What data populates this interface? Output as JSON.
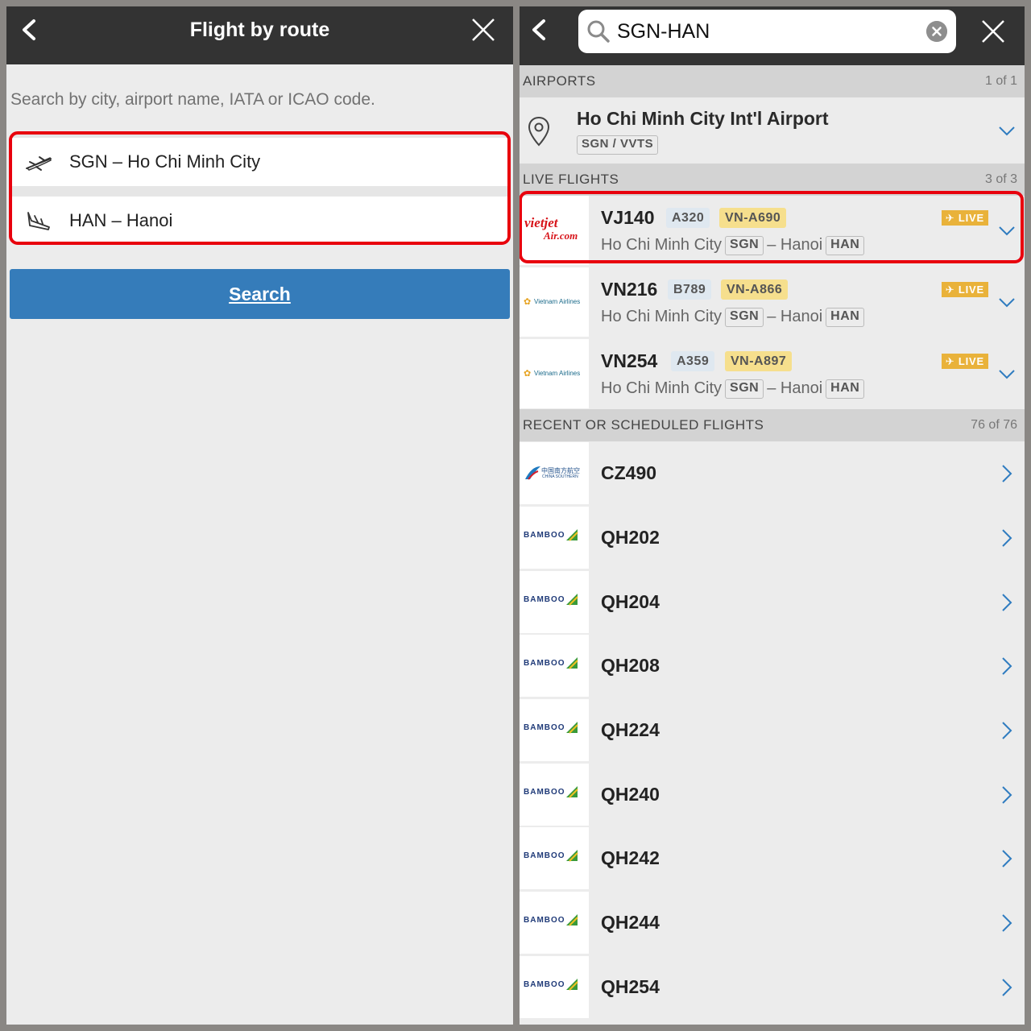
{
  "left": {
    "title": "Flight by route",
    "hint": "Search by city, airport name, IATA or ICAO code.",
    "origin": "SGN – Ho Chi Minh City",
    "destination": "HAN – Hanoi",
    "search_label": "Search"
  },
  "right": {
    "search_value": "SGN-HAN",
    "airports": {
      "title": "AIRPORTS",
      "count": "1 of 1",
      "items": [
        {
          "name": "Ho Chi Minh City Int'l Airport",
          "code": "SGN / VVTS"
        }
      ]
    },
    "live": {
      "title": "LIVE FLIGHTS",
      "count": "3 of 3",
      "badge": "LIVE",
      "items": [
        {
          "flight": "VJ140",
          "aircraft": "A320",
          "reg": "VN-A690",
          "from_city": "Ho Chi Minh City",
          "from_code": "SGN",
          "to_city": "Hanoi",
          "to_code": "HAN",
          "airline_logo": "vietjet-logo",
          "logo_text1": "vietjet",
          "logo_text2": "Air.com"
        },
        {
          "flight": "VN216",
          "aircraft": "B789",
          "reg": "VN-A866",
          "from_city": "Ho Chi Minh City",
          "from_code": "SGN",
          "to_city": "Hanoi",
          "to_code": "HAN",
          "airline_logo": "vietnam-airlines-logo",
          "logo_text1": "Vietnam Airlines"
        },
        {
          "flight": "VN254",
          "aircraft": "A359",
          "reg": "VN-A897",
          "from_city": "Ho Chi Minh City",
          "from_code": "SGN",
          "to_city": "Hanoi",
          "to_code": "HAN",
          "airline_logo": "vietnam-airlines-logo",
          "logo_text1": "Vietnam Airlines"
        }
      ]
    },
    "recent": {
      "title": "RECENT OR SCHEDULED FLIGHTS",
      "count": "76 of 76",
      "items": [
        {
          "flight": "CZ490",
          "airline_logo": "china-southern-logo",
          "logo_text1": "中国南方航空",
          "logo_text2": "CHINA SOUTHERN"
        },
        {
          "flight": "QH202",
          "airline_logo": "bamboo-airways-logo",
          "logo_text1": "BAMBOO"
        },
        {
          "flight": "QH204",
          "airline_logo": "bamboo-airways-logo",
          "logo_text1": "BAMBOO"
        },
        {
          "flight": "QH208",
          "airline_logo": "bamboo-airways-logo",
          "logo_text1": "BAMBOO"
        },
        {
          "flight": "QH224",
          "airline_logo": "bamboo-airways-logo",
          "logo_text1": "BAMBOO"
        },
        {
          "flight": "QH240",
          "airline_logo": "bamboo-airways-logo",
          "logo_text1": "BAMBOO"
        },
        {
          "flight": "QH242",
          "airline_logo": "bamboo-airways-logo",
          "logo_text1": "BAMBOO"
        },
        {
          "flight": "QH244",
          "airline_logo": "bamboo-airways-logo",
          "logo_text1": "BAMBOO"
        },
        {
          "flight": "QH254",
          "airline_logo": "bamboo-airways-logo",
          "logo_text1": "BAMBOO"
        }
      ]
    }
  },
  "colors": {
    "header_bg": "#333333",
    "search_button": "#357cba",
    "highlight_border": "#e8000d",
    "live_badge": "#e9b23a",
    "registration_tag": "#f6df8d",
    "aircraft_tag": "#dfe8f0",
    "chevron": "#2f7cc0"
  }
}
